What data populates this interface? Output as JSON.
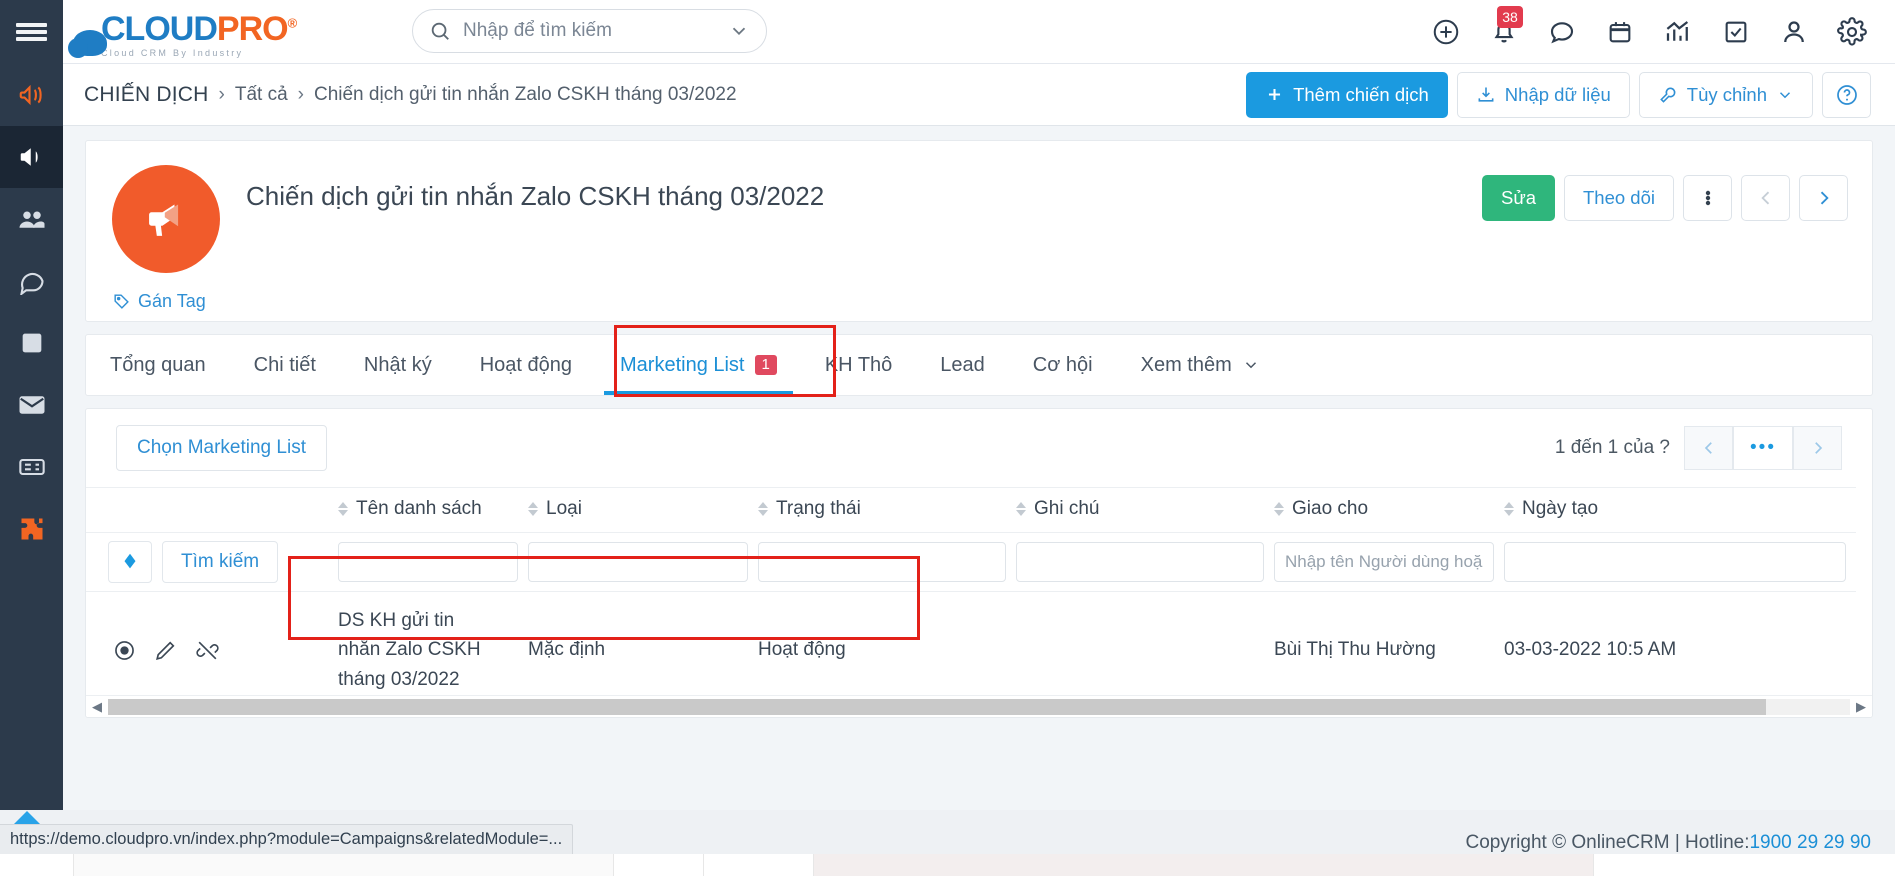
{
  "topbar": {
    "logo": {
      "cloud": "CLOUD",
      "pro": "PRO",
      "reg": "®",
      "sub": "Cloud CRM By Industry"
    },
    "search": {
      "placeholder": "Nhập để tìm kiếm",
      "value": ""
    },
    "notification_count": "38",
    "icons": [
      "add-circle-icon",
      "bell-icon",
      "chat-icon",
      "calendar-icon",
      "analytics-icon",
      "task-icon",
      "user-icon",
      "gear-icon"
    ]
  },
  "breadcrumb": {
    "root": "CHIẾN DỊCH",
    "sep": "›",
    "mid": "Tất cả",
    "last": "Chiến dịch gửi tin nhắn Zalo CSKH tháng 03/2022",
    "actions": {
      "add": "Thêm chiến dịch",
      "import": "Nhập dữ liệu",
      "customize": "Tùy chỉnh",
      "help": "?"
    }
  },
  "hero": {
    "title": "Chiến dịch gửi tin nhắn Zalo CSKH tháng 03/2022",
    "tag_link": "Gán Tag",
    "edit": "Sửa",
    "follow": "Theo dõi"
  },
  "tabs": [
    {
      "label": "Tổng quan",
      "active": false,
      "badge": ""
    },
    {
      "label": "Chi tiết",
      "active": false,
      "badge": ""
    },
    {
      "label": "Nhật ký",
      "active": false,
      "badge": ""
    },
    {
      "label": "Hoạt động",
      "active": false,
      "badge": ""
    },
    {
      "label": "Marketing List",
      "active": true,
      "badge": "1"
    },
    {
      "label": "KH Thô",
      "active": false,
      "badge": ""
    },
    {
      "label": "Lead",
      "active": false,
      "badge": ""
    },
    {
      "label": "Cơ hội",
      "active": false,
      "badge": ""
    },
    {
      "label": "Xem thêm",
      "active": false,
      "badge": ""
    }
  ],
  "list": {
    "select_button": "Chọn Marketing List",
    "pager_text": "1 đến 1 của ?",
    "pager_more": "•••",
    "search_button": "Tìm kiếm",
    "columns": [
      "Tên danh sách",
      "Loại",
      "Trạng thái",
      "Ghi chú",
      "Giao cho",
      "Ngày tạo"
    ],
    "filters": {
      "ten_danh_sach": "",
      "loai": "",
      "trang_thai": "",
      "ghi_chu": "",
      "giao_cho_placeholder": "Nhập tên Người dùng hoặ",
      "ngay_tao": ""
    },
    "rows": [
      {
        "ten_danh_sach": "DS KH gửi tin nhắn Zalo CSKH tháng 03/2022",
        "loai": "Mặc định",
        "trang_thai": "Hoạt động",
        "ghi_chu": "",
        "giao_cho": "Bùi Thị Thu Hường",
        "ngay_tao": "03-03-2022 10:5 AM"
      }
    ]
  },
  "statusbar": {
    "url": "https://demo.cloudpro.vn/index.php?module=Campaigns&relatedModule=..."
  },
  "footer": {
    "copyright": "Copyright © OnlineCRM | Hotline: ",
    "phone": "1900 29 29 90"
  },
  "colors": {
    "accent_blue": "#1b9ae0",
    "brand_orange": "#f26522",
    "green": "#2fb67c",
    "red_badge": "#e0495f",
    "highlight_red": "#e32119",
    "rail_dark": "#2c3a4b"
  }
}
